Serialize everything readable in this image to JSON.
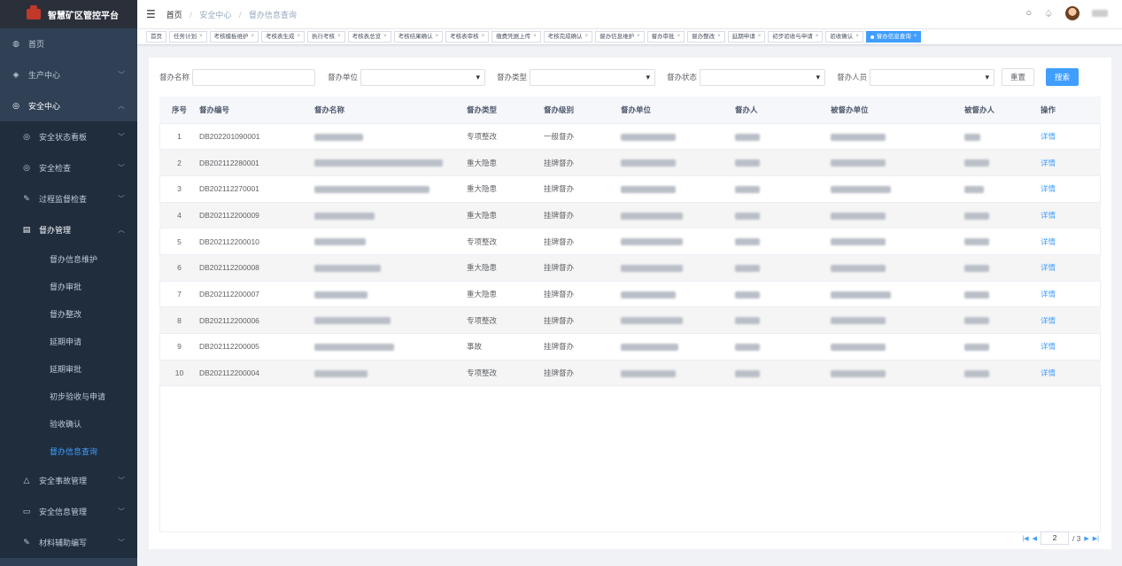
{
  "app": {
    "title": "智慧矿区管控平台"
  },
  "sidebar": {
    "items": [
      {
        "label": "首页",
        "icon": "dashboard-icon"
      },
      {
        "label": "生产中心",
        "icon": "layers-icon"
      },
      {
        "label": "安全中心",
        "icon": "shield-icon"
      },
      {
        "label": "安全状态看板",
        "icon": "shield-icon"
      },
      {
        "label": "安全检查",
        "icon": "shield-icon"
      },
      {
        "label": "过程监督检查",
        "icon": "edit-icon"
      },
      {
        "label": "督办管理",
        "icon": "document-icon"
      },
      {
        "label": "安全事故管理",
        "icon": "warning-icon"
      },
      {
        "label": "安全信息管理",
        "icon": "card-icon"
      },
      {
        "label": "材料辅助编写",
        "icon": "edit-icon"
      }
    ],
    "sub_items": [
      "督办信息维护",
      "督办审批",
      "督办整改",
      "延期申请",
      "延期审批",
      "初步验收与申请",
      "验收确认",
      "督办信息查询"
    ]
  },
  "header": {
    "breadcrumb": [
      "首页",
      "安全中心",
      "督办信息查询"
    ]
  },
  "tags": [
    "首页",
    "任务计划",
    "考核模板维护",
    "考核表生成",
    "执行考核",
    "考核表总览",
    "考核结果确认",
    "考核表审核",
    "缴费凭据上传",
    "考核完成确认",
    "督办信息维护",
    "督办审批",
    "督办整改",
    "延期申请",
    "初步验收与申请",
    "验收确认",
    "督办信息查询"
  ],
  "filters": {
    "name_label": "督办名称",
    "unit_label": "督办单位",
    "type_label": "督办类型",
    "status_label": "督办状态",
    "person_label": "督办人员",
    "reset": "重置",
    "search": "搜索"
  },
  "table": {
    "headers": [
      "序号",
      "督办编号",
      "督办名称",
      "督办类型",
      "督办级别",
      "督办单位",
      "督办人",
      "被督办单位",
      "被督办人",
      "操作"
    ],
    "rows": [
      {
        "idx": "1",
        "code": "DB202201090001",
        "type": "专项整改",
        "level": "一般督办",
        "action": "详情"
      },
      {
        "idx": "2",
        "code": "DB202112280001",
        "type": "重大隐患",
        "level": "挂牌督办",
        "action": "详情"
      },
      {
        "idx": "3",
        "code": "DB202112270001",
        "type": "重大隐患",
        "level": "挂牌督办",
        "action": "详情"
      },
      {
        "idx": "4",
        "code": "DB202112200009",
        "type": "重大隐患",
        "level": "挂牌督办",
        "action": "详情"
      },
      {
        "idx": "5",
        "code": "DB202112200010",
        "type": "专项整改",
        "level": "挂牌督办",
        "action": "详情"
      },
      {
        "idx": "6",
        "code": "DB202112200008",
        "type": "重大隐患",
        "level": "挂牌督办",
        "action": "详情"
      },
      {
        "idx": "7",
        "code": "DB202112200007",
        "type": "重大隐患",
        "level": "挂牌督办",
        "action": "详情"
      },
      {
        "idx": "8",
        "code": "DB202112200006",
        "type": "专项整改",
        "level": "挂牌督办",
        "action": "详情"
      },
      {
        "idx": "9",
        "code": "DB202112200005",
        "type": "事故",
        "level": "挂牌督办",
        "action": "详情"
      },
      {
        "idx": "10",
        "code": "DB202112200004",
        "type": "专项整改",
        "level": "挂牌督办",
        "action": "详情"
      }
    ]
  },
  "pager": {
    "current": "2",
    "total": "/ 3"
  },
  "colors": {
    "accent": "#409eff",
    "sidebar": "#304156",
    "logo_red": "#c0392b"
  }
}
